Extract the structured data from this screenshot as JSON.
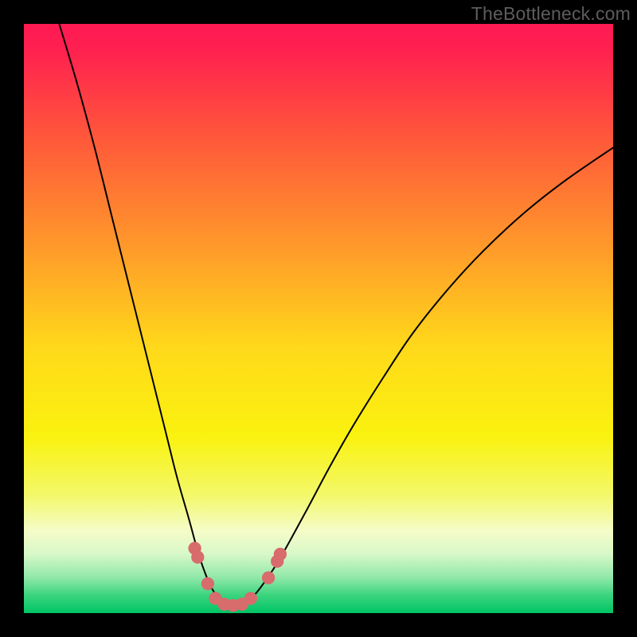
{
  "watermark": "TheBottleneck.com",
  "chart_data": {
    "type": "line",
    "title": "",
    "xlabel": "",
    "ylabel": "",
    "xlim": [
      0,
      100
    ],
    "ylim": [
      0,
      100
    ],
    "background_gradient": {
      "stops": [
        {
          "offset": 0.0,
          "color": "#ff1a53"
        },
        {
          "offset": 0.04,
          "color": "#ff1f50"
        },
        {
          "offset": 0.2,
          "color": "#ff5a3a"
        },
        {
          "offset": 0.38,
          "color": "#ff9a2a"
        },
        {
          "offset": 0.55,
          "color": "#ffd91a"
        },
        {
          "offset": 0.7,
          "color": "#faf20f"
        },
        {
          "offset": 0.8,
          "color": "#f3f86a"
        },
        {
          "offset": 0.86,
          "color": "#f5fcc8"
        },
        {
          "offset": 0.9,
          "color": "#d8f8c8"
        },
        {
          "offset": 0.94,
          "color": "#8fe8a8"
        },
        {
          "offset": 0.97,
          "color": "#3ad47e"
        },
        {
          "offset": 1.0,
          "color": "#00c465"
        }
      ]
    },
    "series": [
      {
        "name": "curve",
        "color": "#000000",
        "points": [
          {
            "x": 6.0,
            "y": 100.0
          },
          {
            "x": 9.0,
            "y": 90.0
          },
          {
            "x": 12.0,
            "y": 79.0
          },
          {
            "x": 15.0,
            "y": 67.0
          },
          {
            "x": 18.0,
            "y": 55.0
          },
          {
            "x": 21.0,
            "y": 43.0
          },
          {
            "x": 24.0,
            "y": 31.0
          },
          {
            "x": 26.0,
            "y": 23.0
          },
          {
            "x": 28.0,
            "y": 16.0
          },
          {
            "x": 29.5,
            "y": 10.5
          },
          {
            "x": 30.5,
            "y": 7.5
          },
          {
            "x": 31.5,
            "y": 5.0
          },
          {
            "x": 32.5,
            "y": 3.2
          },
          {
            "x": 33.5,
            "y": 2.0
          },
          {
            "x": 35.0,
            "y": 1.3
          },
          {
            "x": 36.5,
            "y": 1.3
          },
          {
            "x": 38.0,
            "y": 2.0
          },
          {
            "x": 39.5,
            "y": 3.5
          },
          {
            "x": 41.0,
            "y": 5.5
          },
          {
            "x": 43.0,
            "y": 8.5
          },
          {
            "x": 45.0,
            "y": 12.0
          },
          {
            "x": 48.0,
            "y": 17.5
          },
          {
            "x": 52.0,
            "y": 25.0
          },
          {
            "x": 56.0,
            "y": 32.0
          },
          {
            "x": 61.0,
            "y": 40.0
          },
          {
            "x": 66.0,
            "y": 47.5
          },
          {
            "x": 72.0,
            "y": 55.0
          },
          {
            "x": 78.0,
            "y": 61.5
          },
          {
            "x": 85.0,
            "y": 68.0
          },
          {
            "x": 92.0,
            "y": 73.5
          },
          {
            "x": 100.0,
            "y": 79.0
          }
        ]
      },
      {
        "name": "markers",
        "color": "#d86b6b",
        "radius": 1.1,
        "points": [
          {
            "x": 29.0,
            "y": 11.0
          },
          {
            "x": 29.5,
            "y": 9.5
          },
          {
            "x": 31.2,
            "y": 5.0
          },
          {
            "x": 32.5,
            "y": 2.5
          },
          {
            "x": 34.0,
            "y": 1.5
          },
          {
            "x": 35.5,
            "y": 1.3
          },
          {
            "x": 37.0,
            "y": 1.5
          },
          {
            "x": 38.5,
            "y": 2.5
          },
          {
            "x": 41.5,
            "y": 6.0
          },
          {
            "x": 43.0,
            "y": 8.8
          },
          {
            "x": 43.5,
            "y": 10.0
          }
        ]
      }
    ]
  }
}
